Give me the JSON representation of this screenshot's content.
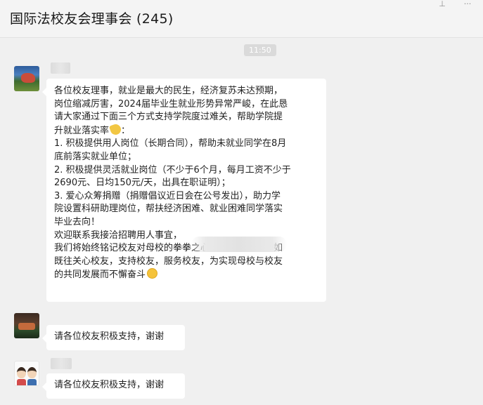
{
  "header": {
    "title": "国际法校友会理事会 (245)",
    "pin_icon": "pin-icon",
    "more_icon": "more-icon"
  },
  "timestamp": "11:50",
  "messages": [
    {
      "avatar_icon": "landscape-avatar",
      "lines": [
        "各位校友理事，就业是最大的民生，经济复苏未达预期，",
        "岗位缩减厉害，2024届毕业生就业形势异常严峻，在此恳",
        "请大家通过下面三个方式支持学院度过难关，帮助学院提",
        "升就业落实率",
        "1. 积极提供用人岗位（长期合同），帮助未就业同学在8月",
        "底前落实就业单位；",
        "2. 积极提供灵活就业岗位（不少于6个月，每月工资不少于",
        "2690元、日均150元/天，出具在职证明）；",
        "3. 爱心众筹捐赠（捐赠倡议近日会在公号发出），助力学",
        "院设置科研助理岗位，帮扶经济困难、就业困难同学落实",
        "毕业去向！",
        "欢迎联系我接洽招聘用人事宜，",
        "我们将始终铭记校友对母校的拳拳之心和殷殷深情，一如",
        "既往关心校友，支持校友，服务校友，为实现母校与校友",
        "的共同发展而不懈奋斗"
      ],
      "emoji_1": "strong-arm-emoji",
      "emoji_2": "fighting-emoji"
    },
    {
      "avatar_icon": "photo-avatar",
      "text": "请各位校友积极支持，谢谢"
    },
    {
      "avatar_icon": "cartoon-couple-avatar",
      "text": "请各位校友积极支持，谢谢"
    }
  ]
}
